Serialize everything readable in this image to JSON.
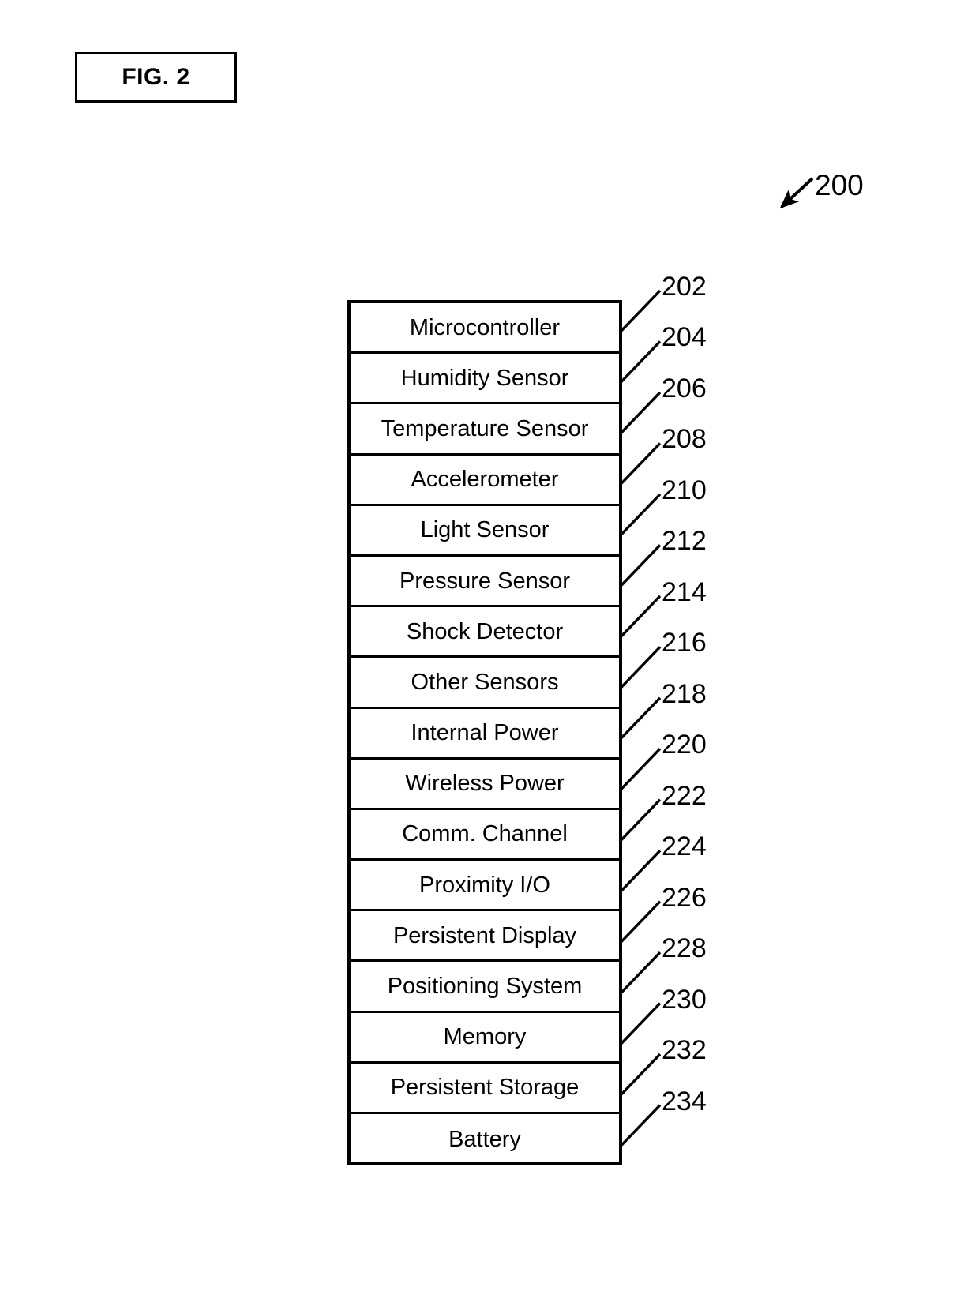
{
  "figure": {
    "label": "FIG. 2",
    "overall_ref": "200"
  },
  "diagram": {
    "type": "patent-block-stack",
    "rows": [
      {
        "label": "Microcontroller",
        "ref": "202"
      },
      {
        "label": "Humidity Sensor",
        "ref": "204"
      },
      {
        "label": "Temperature Sensor",
        "ref": "206"
      },
      {
        "label": "Accelerometer",
        "ref": "208"
      },
      {
        "label": "Light Sensor",
        "ref": "210"
      },
      {
        "label": "Pressure Sensor",
        "ref": "212"
      },
      {
        "label": "Shock Detector",
        "ref": "214"
      },
      {
        "label": "Other Sensors",
        "ref": "216"
      },
      {
        "label": "Internal Power",
        "ref": "218"
      },
      {
        "label": "Wireless Power",
        "ref": "220"
      },
      {
        "label": "Comm. Channel",
        "ref": "222"
      },
      {
        "label": "Proximity I/O",
        "ref": "224"
      },
      {
        "label": "Persistent Display",
        "ref": "226"
      },
      {
        "label": "Positioning System",
        "ref": "228"
      },
      {
        "label": "Memory",
        "ref": "230"
      },
      {
        "label": "Persistent Storage",
        "ref": "232"
      },
      {
        "label": "Battery",
        "ref": "234"
      }
    ]
  },
  "colors": {
    "ink": "#000000",
    "page": "#ffffff"
  }
}
